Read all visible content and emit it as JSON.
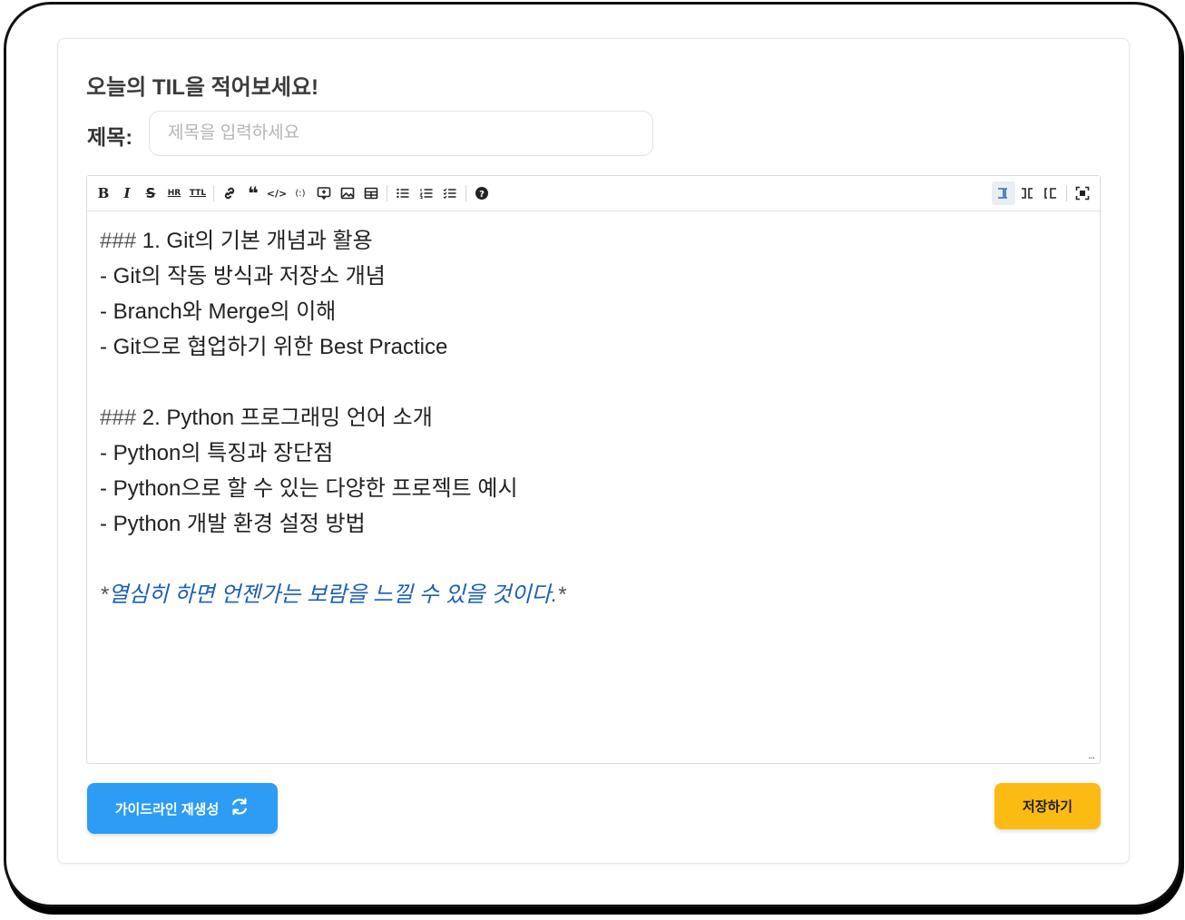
{
  "page": {
    "heading": "오늘의 TIL을 적어보세요!",
    "title_label": "제목:",
    "title_placeholder": "제목을 입력하세요",
    "title_value": ""
  },
  "toolbar": {
    "left_icons": [
      "bold-icon",
      "italic-icon",
      "strikethrough-icon",
      "hr-icon",
      "table-title-icon",
      "link-icon",
      "quote-icon",
      "code-icon",
      "code-block-icon",
      "comment-icon",
      "image-icon",
      "table-icon",
      "unordered-list-icon",
      "ordered-list-icon",
      "checklist-icon",
      "help-icon"
    ],
    "right_icons": [
      "edit-mode-icon",
      "live-mode-icon",
      "preview-mode-icon",
      "fullscreen-icon"
    ],
    "active_mode": "edit"
  },
  "editor": {
    "lines": [
      {
        "kind": "heading",
        "hash": "###",
        "text": " 1. Git의 기본 개념과 활용"
      },
      {
        "kind": "item",
        "text": "- Git의 작동 방식과 저장소 개념"
      },
      {
        "kind": "item",
        "text": "- Branch와 Merge의 이해"
      },
      {
        "kind": "item",
        "text": "- Git으로 협업하기 위한 Best Practice"
      },
      {
        "kind": "blank",
        "text": ""
      },
      {
        "kind": "heading",
        "hash": "###",
        "text": " 2. Python 프로그래밍 언어 소개"
      },
      {
        "kind": "item",
        "text": "- Python의 특징과 장단점"
      },
      {
        "kind": "item",
        "text": "- Python으로 할 수 있는 다양한 프로젝트 예시"
      },
      {
        "kind": "item",
        "text": "- Python 개발 환경 설정 방법"
      },
      {
        "kind": "blank",
        "text": ""
      },
      {
        "kind": "italic",
        "star": "*",
        "text": "열심히 하면 언젠가는 보람을 느낄 수 있을 것이다."
      }
    ],
    "resize_handle": "..."
  },
  "buttons": {
    "guide_label": "가이드라인 재생성",
    "guide_icon": "refresh-icon",
    "guide_color": "#2c9cf4",
    "save_label": "저장하기",
    "save_color": "#fbbb12"
  }
}
